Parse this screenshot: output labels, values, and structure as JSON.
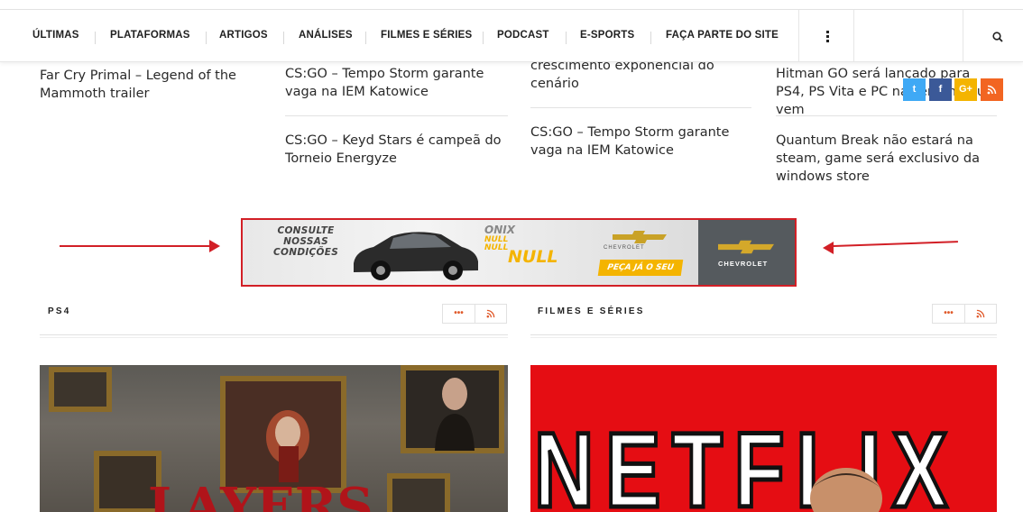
{
  "nav": {
    "items": [
      {
        "label": "ÚLTIMAS"
      },
      {
        "label": "PLATAFORMAS"
      },
      {
        "label": "ARTIGOS"
      },
      {
        "label": "ANÁLISES"
      },
      {
        "label": "FILMES E SÉRIES"
      },
      {
        "label": "PODCAST"
      },
      {
        "label": "E-SPORTS"
      },
      {
        "label": "FAÇA PARTE DO SITE"
      }
    ],
    "more_icon": "vertical-dots-icon",
    "search_icon": "search-icon"
  },
  "news": {
    "col1": [
      "Far Cry Primal – Legend of the Mammoth trailer"
    ],
    "col2": [
      "CS:GO – Tempo Storm garante vaga na IEM Katowice",
      "CS:GO – Keyd Stars é campeã do Torneio Energyze"
    ],
    "col3": [
      "crescimento exponencial do cenário",
      "CS:GO – Tempo Storm garante vaga na IEM Katowice"
    ],
    "col4": [
      "Hitman GO será lançado para PS4, PS Vita e PC na semana que vem",
      "Quantum Break não estará na steam, game será exclusivo da windows store"
    ]
  },
  "social": [
    {
      "icon": "twitter-icon",
      "glyph": "t",
      "color": "#3fa9f5"
    },
    {
      "icon": "facebook-icon",
      "glyph": "f",
      "color": "#3b5998"
    },
    {
      "icon": "google-plus-icon",
      "glyph": "G+",
      "color": "#f4b400"
    },
    {
      "icon": "rss-icon",
      "glyph": "ʒ",
      "color": "#f26522"
    }
  ],
  "ad": {
    "conditions": "CONSULTE NOSSAS CONDIÇÕES",
    "conditions_l1": "CONSULTE",
    "conditions_l2": "NOSSAS",
    "conditions_l3": "CONDIÇÕES",
    "model_l1": "ONIX",
    "model_l2": "NULL",
    "model_l3": "NULL",
    "model_l4": "NULL",
    "brand_small": "CHEVROLET",
    "cta": "PEÇA JÁ O SEU",
    "brand": "CHEVROLET",
    "border_color": "#d21f26"
  },
  "sections": [
    {
      "title": "PS4",
      "more": "•••",
      "rss_icon": "rss-icon"
    },
    {
      "title": "FILMES E SÉRIES",
      "more": "•••",
      "rss_icon": "rss-icon"
    }
  ],
  "images": {
    "ps4_word": "LAYERS",
    "netflix_word": "NETFLIX"
  }
}
